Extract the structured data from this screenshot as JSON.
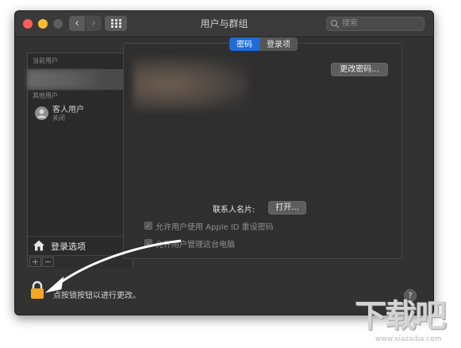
{
  "window": {
    "title": "用户与群组"
  },
  "search": {
    "placeholder": "搜索"
  },
  "sidebar": {
    "current_users_label": "当前用户",
    "other_users_label": "其他用户",
    "guest": {
      "name": "客人用户",
      "status": "关闭"
    },
    "login_options": "登录选项",
    "add": "+",
    "remove": "−"
  },
  "tabs": [
    {
      "label": "密码",
      "selected": true
    },
    {
      "label": "登录项",
      "selected": false
    }
  ],
  "content": {
    "change_password": "更改密码...",
    "contact_card_label": "联系人名片:",
    "open_button": "打开...",
    "checkbox_apple_id": "允许用户使用 Apple ID 重设密码",
    "checkbox_admin": "允许用户管理这台电脑"
  },
  "footer": {
    "lock_text": "点按锁按钮以进行更改。",
    "help": "?"
  },
  "watermark": {
    "text": "下载吧",
    "url": "www.xiazaiba.com"
  },
  "colors": {
    "accent": "#1f6bd8",
    "lock": "#f5a623",
    "window_bg": "#323232"
  }
}
